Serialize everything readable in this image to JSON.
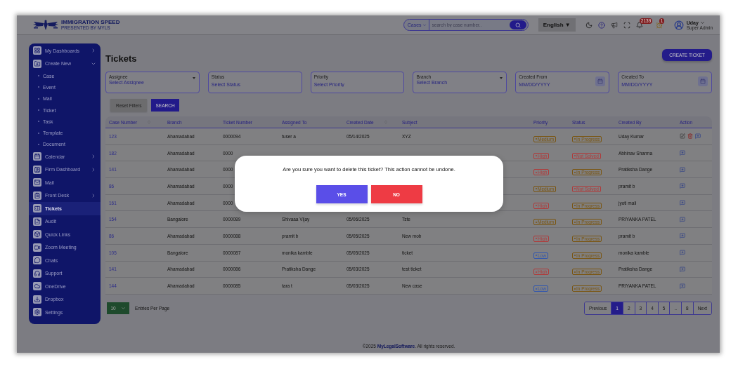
{
  "header": {
    "logo": {
      "title": "IMMIGRATION SPEED",
      "subtitle": "PRESENTED BY MYLS"
    },
    "search": {
      "scope": "Cases",
      "placeholder": "search by case number.."
    },
    "language": "English ▼",
    "notifications": {
      "bell_count": "2139",
      "alarm_count": "1"
    },
    "user": {
      "name": "Uday",
      "role": "Super Admin"
    }
  },
  "sidebar": {
    "items": [
      {
        "label": "My Dashboards",
        "expanded": false,
        "selected": false
      },
      {
        "label": "Create New",
        "expanded": true,
        "selected": false,
        "children": [
          {
            "label": "Case",
            "selected": false
          },
          {
            "label": "Event",
            "selected": false
          },
          {
            "label": "Mail",
            "selected": false
          },
          {
            "label": "Ticket",
            "selected": false
          },
          {
            "label": "Task",
            "selected": false
          },
          {
            "label": "Template",
            "selected": false
          },
          {
            "label": "Document",
            "selected": false
          }
        ]
      },
      {
        "label": "Calendar",
        "expanded": false,
        "selected": false
      },
      {
        "label": "Firm Dashboard",
        "expanded": false,
        "selected": false
      },
      {
        "label": "Mail",
        "selected": false
      },
      {
        "label": "Front Desk",
        "expanded": false,
        "selected": false
      },
      {
        "label": "Tickets",
        "selected": true
      },
      {
        "label": "Audit",
        "selected": false
      },
      {
        "label": "Quick Links",
        "selected": false
      },
      {
        "label": "Zoom Meeting",
        "selected": false
      },
      {
        "label": "Chats",
        "selected": false
      },
      {
        "label": "Support",
        "selected": false
      },
      {
        "label": "OneDrive",
        "selected": false
      },
      {
        "label": "Dropbox",
        "selected": false
      },
      {
        "label": "Settings",
        "selected": false
      }
    ]
  },
  "page": {
    "title": "Tickets",
    "create_button": "CREATE TICKET"
  },
  "filters": [
    {
      "kind": "dropdown",
      "label": "Assignee",
      "placeholder": "Select Assignee"
    },
    {
      "kind": "select",
      "label": "Status",
      "placeholder": "Select Status"
    },
    {
      "kind": "select",
      "label": "Priority",
      "placeholder": "Select Priority"
    },
    {
      "kind": "dropdown",
      "label": "Branch",
      "placeholder": "Select Branch"
    },
    {
      "kind": "date",
      "label": "Created From",
      "placeholder": "MM/DD/YYYY"
    },
    {
      "kind": "date",
      "label": "Created To",
      "placeholder": "MM/DD/YYYY"
    }
  ],
  "filter_buttons": {
    "reset": "Reset Filters",
    "search": "SEARCH"
  },
  "table": {
    "columns": [
      {
        "label": "Case Number",
        "sortable": true
      },
      {
        "label": "Branch",
        "sortable": false
      },
      {
        "label": "Ticket Number",
        "sortable": false
      },
      {
        "label": "Assigned To",
        "sortable": false
      },
      {
        "label": "Created Date",
        "sortable": true
      },
      {
        "label": "Subject",
        "sortable": false
      },
      {
        "label": "Priority",
        "sortable": false
      },
      {
        "label": "Status",
        "sortable": false
      },
      {
        "label": "Created By",
        "sortable": false
      },
      {
        "label": "Action",
        "sortable": false
      }
    ],
    "rows": [
      {
        "case": "123",
        "branch": "Ahamadabad",
        "ticket": "0000094",
        "assigned": "tuser a",
        "date": "05/14/2025",
        "subject": "XYZ",
        "priority": {
          "label": "Medium",
          "color": "#7a5510"
        },
        "status": {
          "label": "In Progress",
          "color": "#7a5510"
        },
        "created_by": "Uday Kumar",
        "actions": [
          {
            "kind": "edit"
          },
          {
            "kind": "delete"
          },
          {
            "kind": "comment"
          }
        ]
      },
      {
        "case": "182",
        "branch": "Ahamadabad",
        "ticket": "0000",
        "priority": {
          "label": "High",
          "color": "#b03a3a"
        },
        "status": {
          "label": "Not Solved",
          "color": "#b03a3a"
        },
        "created_by": "Abhinav Sharma",
        "actions": [
          {
            "kind": "comment"
          }
        ]
      },
      {
        "case": "141",
        "branch": "Ahamadabad",
        "ticket": "0000",
        "priority": {
          "label": "High",
          "color": "#b03a3a"
        },
        "status": {
          "label": "In Progress",
          "color": "#7a5510"
        },
        "created_by": "Pratiksha Dange",
        "actions": [
          {
            "kind": "comment"
          }
        ]
      },
      {
        "case": "86",
        "branch": "Ahamadabad",
        "ticket": "0000",
        "priority": {
          "label": "Medium",
          "color": "#7a5510"
        },
        "status": {
          "label": "Not Solved",
          "color": "#b03a3a"
        },
        "created_by": "pramit b",
        "actions": [
          {
            "kind": "comment"
          }
        ]
      },
      {
        "case": "161",
        "branch": "Ahamadabad",
        "ticket": "0000",
        "priority": {
          "label": "High",
          "color": "#b03a3a"
        },
        "status": {
          "label": "In Progress",
          "color": "#7a5510"
        },
        "created_by": "jyoti mali",
        "actions": [
          {
            "kind": "comment"
          }
        ]
      },
      {
        "case": "154",
        "branch": "Bangalore",
        "ticket": "0000089",
        "assigned": "Shivaaa Vijay",
        "date": "05/06/2025",
        "subject": "Tste",
        "priority": {
          "label": "Medium",
          "color": "#7a5510"
        },
        "status": {
          "label": "In Progress",
          "color": "#7a5510"
        },
        "created_by": "PRIYANKA PATEL",
        "actions": [
          {
            "kind": "comment"
          }
        ]
      },
      {
        "case": "86",
        "branch": "Ahamadabad",
        "ticket": "0000088",
        "assigned": "pramit b",
        "date": "05/05/2025",
        "subject": "New mob",
        "priority": {
          "label": "High",
          "color": "#b03a3a"
        },
        "status": {
          "label": "In Progress",
          "color": "#7a5510"
        },
        "created_by": "pramit b",
        "actions": [
          {
            "kind": "comment"
          }
        ]
      },
      {
        "case": "105",
        "branch": "Bangalore",
        "ticket": "0000087",
        "assigned": "monika kamble",
        "date": "05/05/2025",
        "subject": "ticket",
        "priority": {
          "label": "Low",
          "color": "#2f55b0"
        },
        "status": {
          "label": "In Progress",
          "color": "#7a5510"
        },
        "created_by": "monika kamble",
        "actions": [
          {
            "kind": "comment"
          }
        ]
      },
      {
        "case": "141",
        "branch": "Ahamadabad",
        "ticket": "0000086",
        "assigned": "Pratiksha Dange",
        "date": "05/03/2025",
        "subject": "test ticket",
        "priority": {
          "label": "High",
          "color": "#b03a3a"
        },
        "status": {
          "label": "In Progress",
          "color": "#7a5510"
        },
        "created_by": "Pratiksha Dange",
        "actions": [
          {
            "kind": "comment"
          }
        ]
      },
      {
        "case": "144",
        "branch": "Ahamadabad",
        "ticket": "0000085",
        "assigned": "tara t",
        "date": "05/03/2025",
        "subject": "New case",
        "priority": {
          "label": "Low",
          "color": "#2f55b0"
        },
        "status": {
          "label": "In Progress",
          "color": "#7a5510"
        },
        "created_by": "PRIYANKA PATEL",
        "actions": [
          {
            "kind": "comment"
          }
        ]
      }
    ]
  },
  "entries": {
    "value": "10",
    "label": "Entries Per Page"
  },
  "pagination": [
    {
      "label": "Previous",
      "selected": false
    },
    {
      "label": "1",
      "selected": true
    },
    {
      "label": "2",
      "selected": false
    },
    {
      "label": "3",
      "selected": false
    },
    {
      "label": "4",
      "selected": false
    },
    {
      "label": "5",
      "selected": false
    },
    {
      "label": "..",
      "selected": false
    },
    {
      "label": "8",
      "selected": false
    },
    {
      "label": "Next",
      "selected": false
    }
  ],
  "footer": "©2025 **MyLegalSoftware**. All rights reserved.",
  "dialog": {
    "message": "Are you sure you want to delete this ticket? This action cannot be undone.",
    "confirm": "YES",
    "cancel": "NO"
  }
}
